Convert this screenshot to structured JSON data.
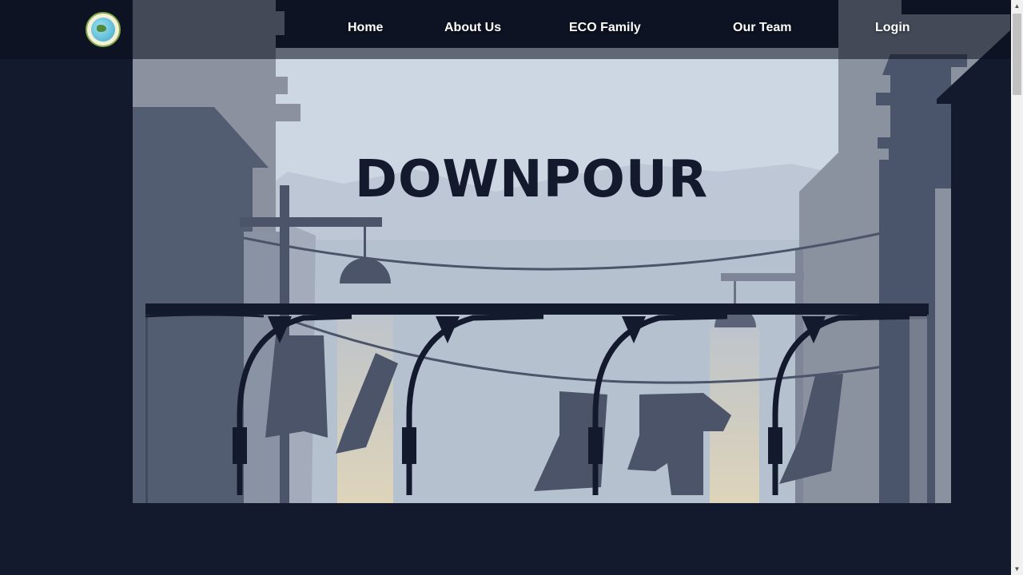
{
  "nav": {
    "links": [
      {
        "label": "Home"
      },
      {
        "label": "About Us"
      },
      {
        "label": "ECO Family"
      },
      {
        "label": "Our Team"
      },
      {
        "label": "Login"
      }
    ]
  },
  "hero": {
    "title": "DOWNPOUR"
  },
  "colors": {
    "background": "#141a2d",
    "sky": "#cdd6e3",
    "title": "#141a2d",
    "nav_text": "#ffffff"
  },
  "icons": {
    "logo": "globe-emblem-icon",
    "scroll_up": "triangle-up-icon",
    "scroll_down": "triangle-down-icon"
  }
}
